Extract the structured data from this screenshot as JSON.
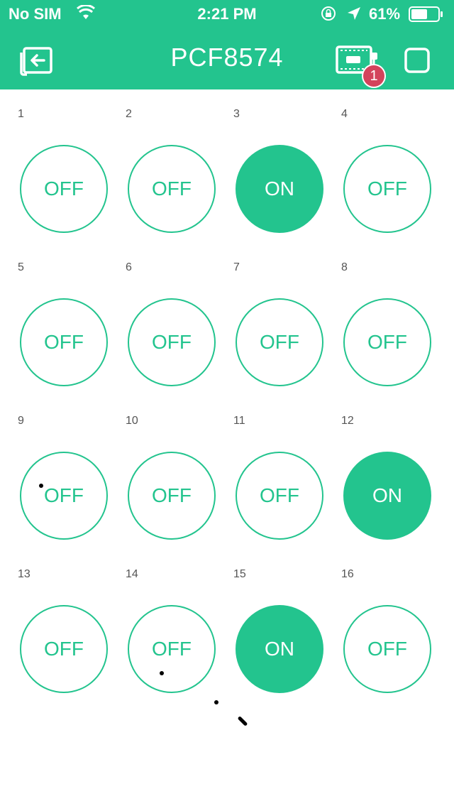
{
  "status_bar": {
    "carrier": "No SIM",
    "time": "2:21 PM",
    "battery_percent": "61%",
    "battery_level": 0.61
  },
  "nav": {
    "title": "PCF8574",
    "notification_count": "1"
  },
  "buttons": [
    {
      "pin": "1",
      "state": "OFF",
      "on": false
    },
    {
      "pin": "2",
      "state": "OFF",
      "on": false
    },
    {
      "pin": "3",
      "state": "ON",
      "on": true
    },
    {
      "pin": "4",
      "state": "OFF",
      "on": false
    },
    {
      "pin": "5",
      "state": "OFF",
      "on": false
    },
    {
      "pin": "6",
      "state": "OFF",
      "on": false
    },
    {
      "pin": "7",
      "state": "OFF",
      "on": false
    },
    {
      "pin": "8",
      "state": "OFF",
      "on": false
    },
    {
      "pin": "9",
      "state": "OFF",
      "on": false
    },
    {
      "pin": "10",
      "state": "OFF",
      "on": false
    },
    {
      "pin": "11",
      "state": "OFF",
      "on": false
    },
    {
      "pin": "12",
      "state": "ON",
      "on": true
    },
    {
      "pin": "13",
      "state": "OFF",
      "on": false
    },
    {
      "pin": "14",
      "state": "OFF",
      "on": false
    },
    {
      "pin": "15",
      "state": "ON",
      "on": true
    },
    {
      "pin": "16",
      "state": "OFF",
      "on": false
    }
  ],
  "colors": {
    "accent": "#23c48e",
    "badge": "#d3435c"
  }
}
